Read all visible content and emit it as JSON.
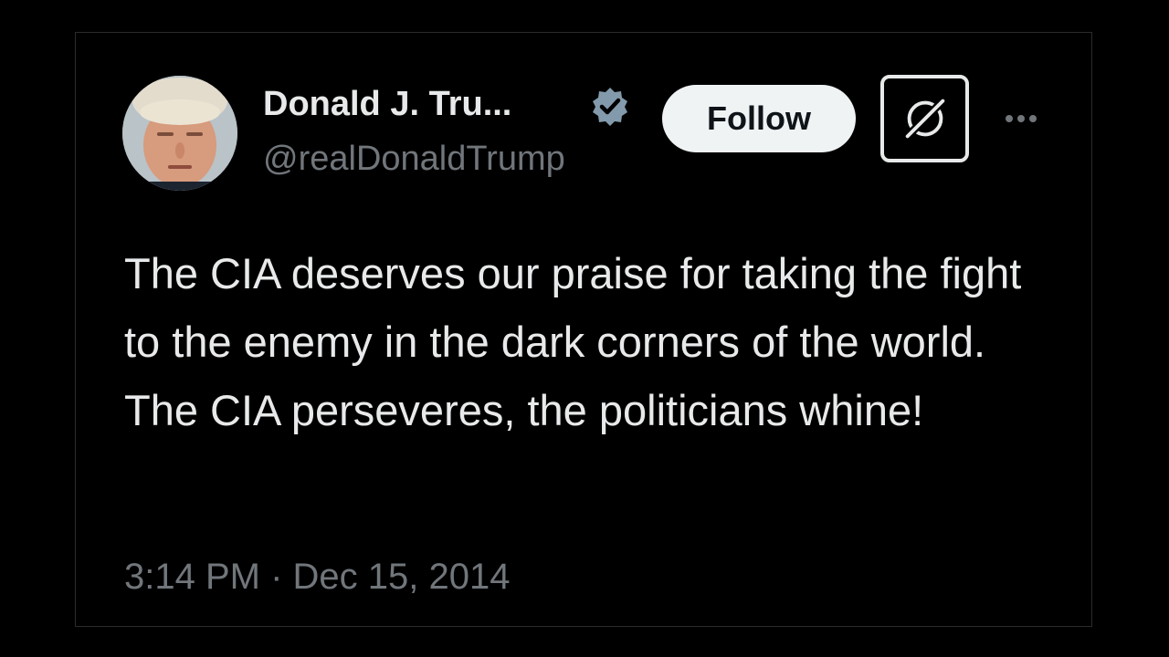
{
  "author": {
    "display_name": "Donald J. Tru...",
    "handle": "@realDonaldTrump",
    "verified_icon": "verified-badge-icon",
    "avatar": "profile-photo"
  },
  "actions": {
    "follow_label": "Follow",
    "grok_icon": "grok-icon",
    "more_icon": "more-options-icon"
  },
  "tweet": {
    "text": "The CIA deserves our praise for taking the fight to the enemy in the dark corners of the world. The CIA perseveres, the politicians whine!",
    "timestamp": "3:14 PM · Dec 15, 2014"
  },
  "colors": {
    "background": "#000000",
    "text_primary": "#e7e9ea",
    "text_secondary": "#71767b",
    "follow_button": "#eff3f4"
  }
}
